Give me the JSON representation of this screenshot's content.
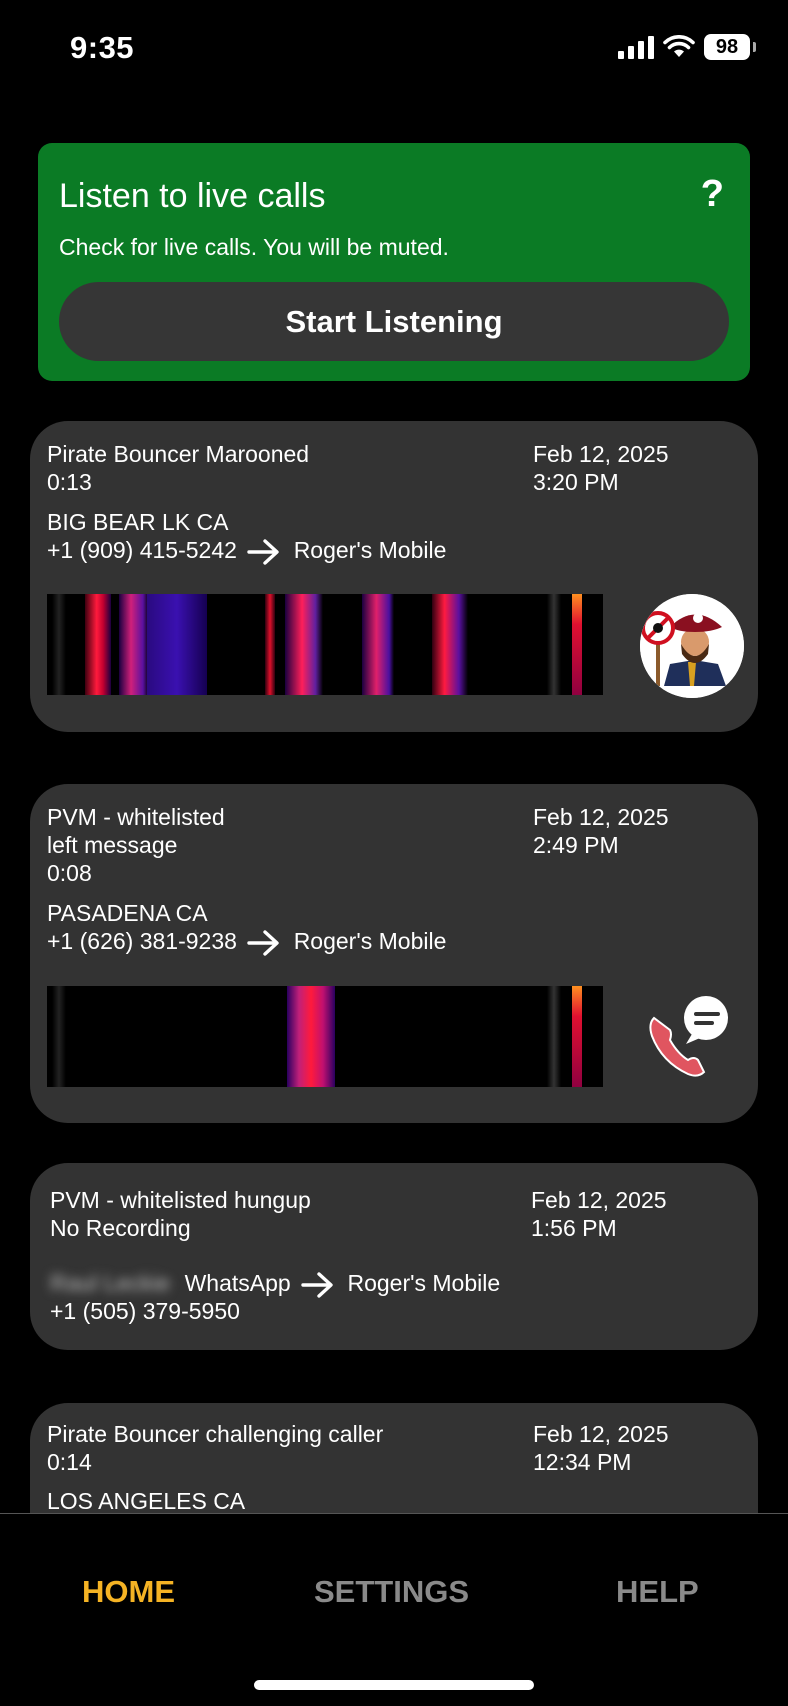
{
  "status": {
    "time": "9:35",
    "battery": "98"
  },
  "live": {
    "title": "Listen to live calls",
    "help": "?",
    "subtitle": "Check for live calls. You will be muted.",
    "button": "Start Listening"
  },
  "calls": [
    {
      "status": "Pirate Bouncer Marooned",
      "duration": "0:13",
      "date": "Feb 12, 2025",
      "time": "3:20 PM",
      "location": "BIG BEAR LK CA",
      "number": "+1 (909) 415-5242",
      "target": "Roger's Mobile",
      "icon": "pirate-bouncer-icon"
    },
    {
      "status": "PVM - whitelisted",
      "note": "left message",
      "duration": "0:08",
      "date": "Feb 12, 2025",
      "time": "2:49 PM",
      "location": "PASADENA CA",
      "number": "+1 (626) 381-9238",
      "target": "Roger's Mobile",
      "icon": "voicemail-message-icon"
    },
    {
      "status": "PVM - whitelisted hungup",
      "note": "No Recording",
      "date": "Feb 12, 2025",
      "time": "1:56 PM",
      "caller_name": "Raul Leckie",
      "source": "WhatsApp",
      "number": "+1 (505) 379-5950",
      "target": "Roger's Mobile"
    },
    {
      "status": "Pirate Bouncer challenging caller",
      "duration": "0:14",
      "date": "Feb 12, 2025",
      "time": "12:34 PM",
      "location": "LOS ANGELES CA"
    }
  ],
  "tabs": {
    "home": "HOME",
    "settings": "SETTINGS",
    "help": "HELP"
  },
  "colors": {
    "accent_green": "#0b7b25",
    "active_tab": "#f5b324",
    "card_bg": "#333333"
  }
}
